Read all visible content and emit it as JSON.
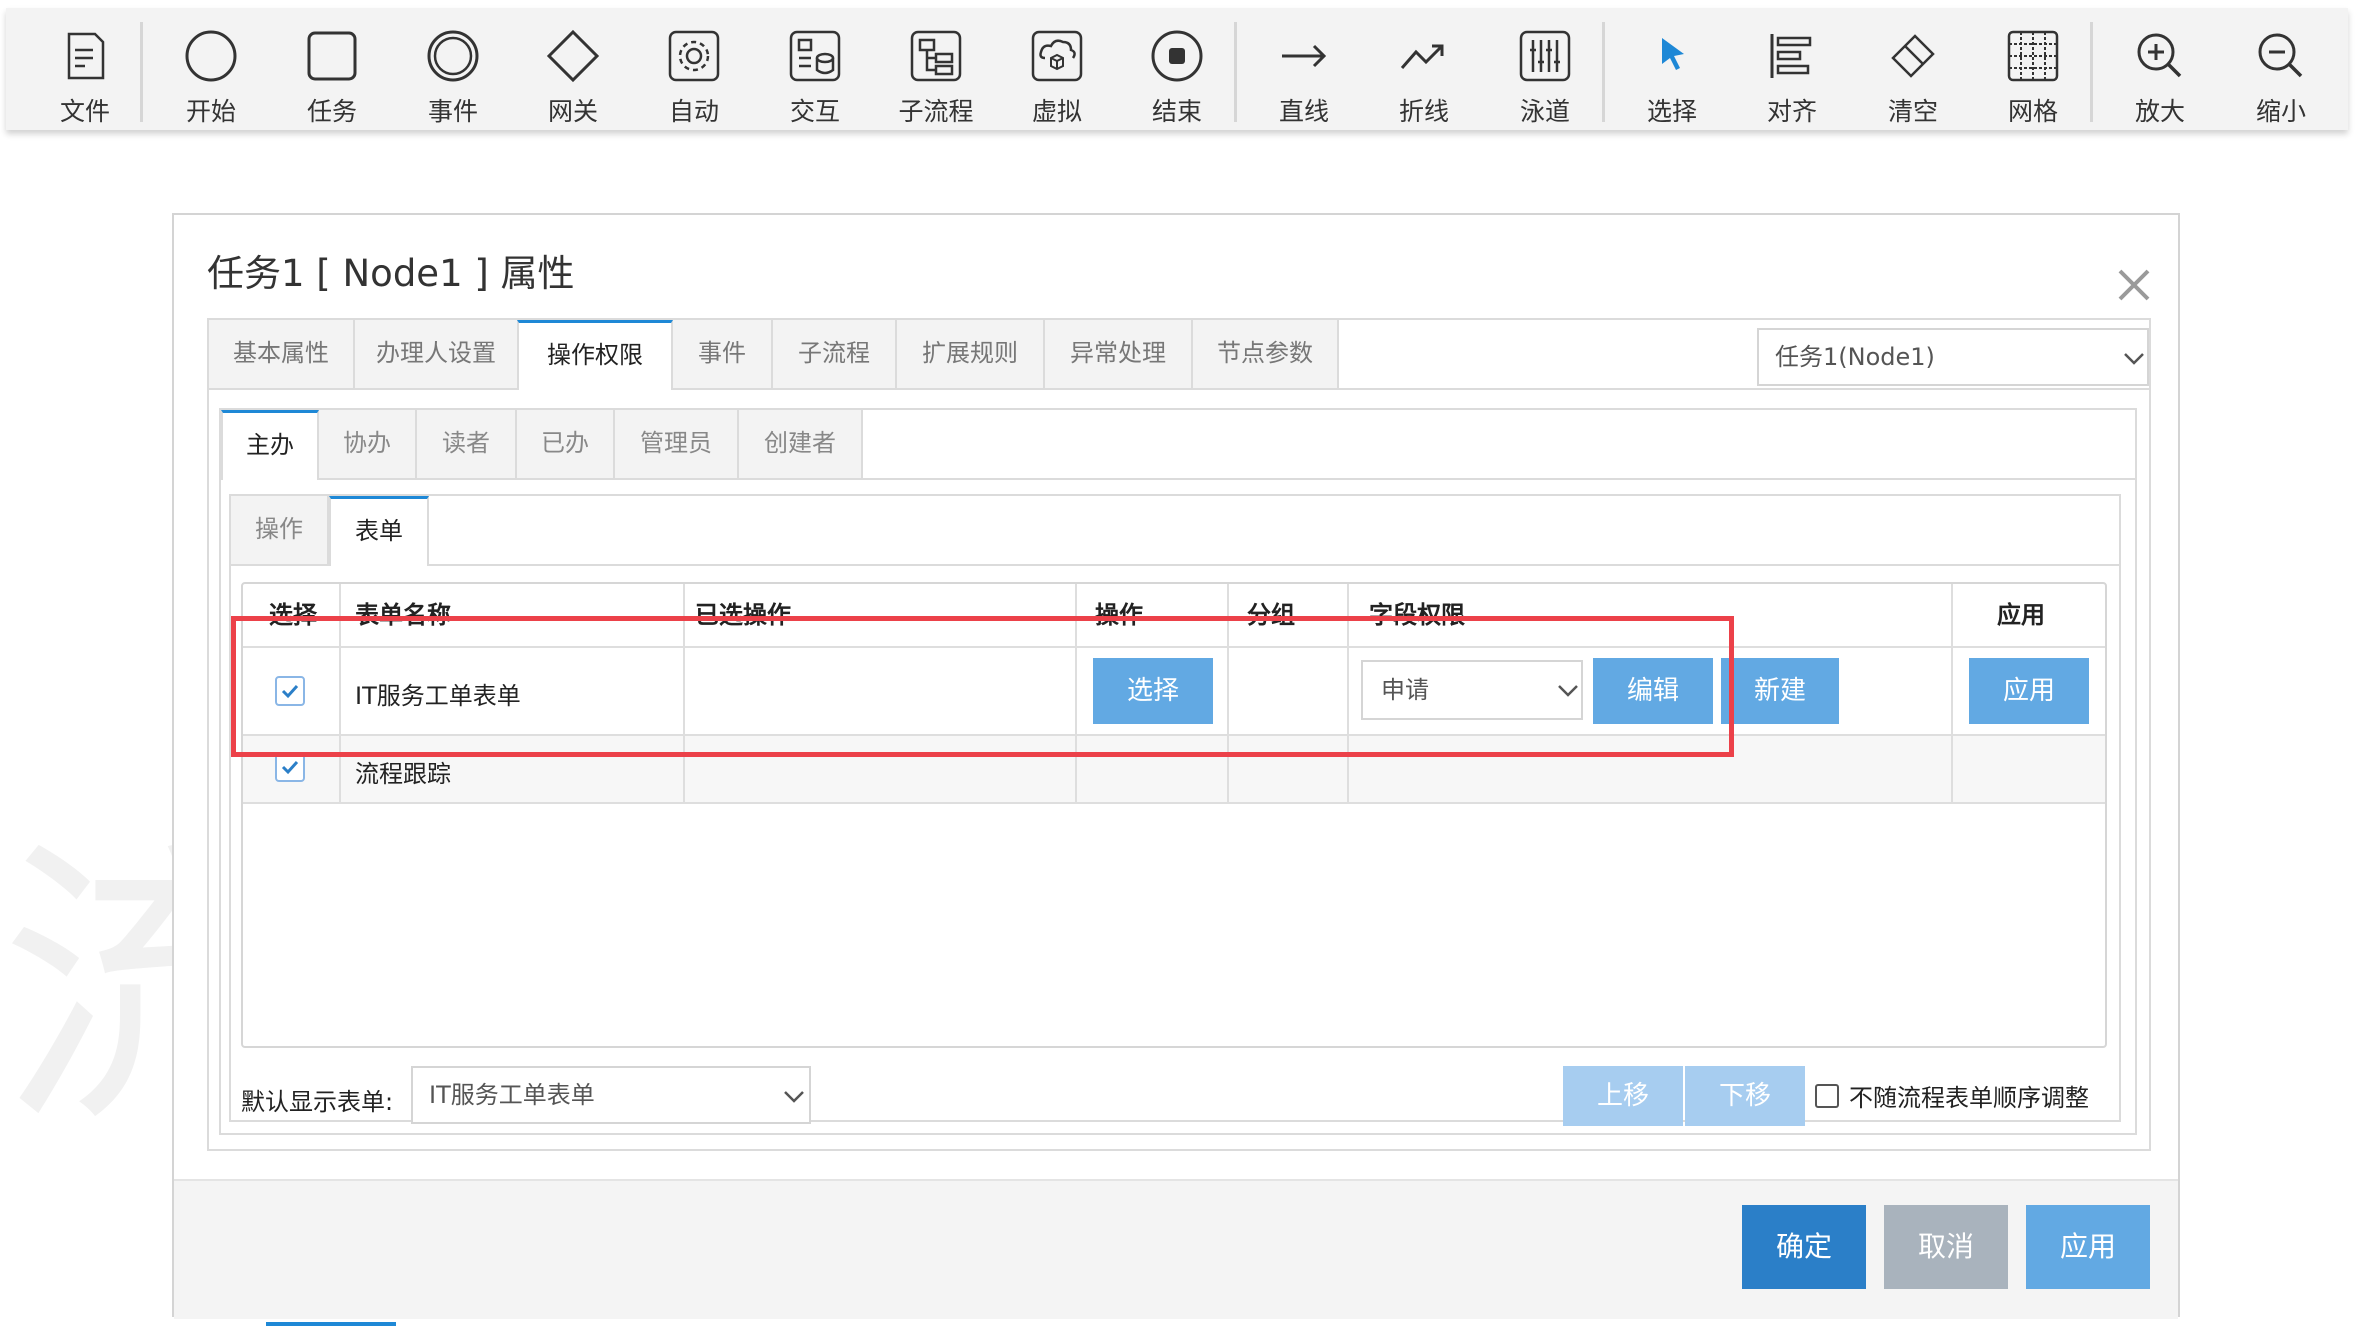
{
  "toolbar": {
    "items": [
      {
        "label": "文件",
        "icon": "file-icon"
      },
      {
        "label": "开始",
        "icon": "start-circle-icon"
      },
      {
        "label": "任务",
        "icon": "task-square-icon"
      },
      {
        "label": "事件",
        "icon": "event-double-circle-icon"
      },
      {
        "label": "网关",
        "icon": "gateway-diamond-icon"
      },
      {
        "label": "自动",
        "icon": "automatic-gear-icon"
      },
      {
        "label": "交互",
        "icon": "interaction-icon"
      },
      {
        "label": "子流程",
        "icon": "subprocess-icon"
      },
      {
        "label": "虚拟",
        "icon": "virtual-cube-icon"
      },
      {
        "label": "结束",
        "icon": "end-circle-icon"
      },
      {
        "label": "直线",
        "icon": "straight-arrow-icon"
      },
      {
        "label": "折线",
        "icon": "polyline-arrow-icon"
      },
      {
        "label": "泳道",
        "icon": "swimlane-icon"
      },
      {
        "label": "选择",
        "icon": "select-cursor-icon"
      },
      {
        "label": "对齐",
        "icon": "align-icon"
      },
      {
        "label": "清空",
        "icon": "clear-eraser-icon"
      },
      {
        "label": "网格",
        "icon": "grid-icon"
      },
      {
        "label": "放大",
        "icon": "zoom-in-icon"
      },
      {
        "label": "缩小",
        "icon": "zoom-out-icon"
      }
    ]
  },
  "watermark": "流",
  "dialog": {
    "title": "任务1 [ Node1 ] 属性",
    "tabs": [
      "基本属性",
      "办理人设置",
      "操作权限",
      "事件",
      "子流程",
      "扩展规则",
      "异常处理",
      "节点参数"
    ],
    "active_tab": "操作权限",
    "node_select": "任务1(Node1)",
    "role_tabs": [
      "主办",
      "协办",
      "读者",
      "已办",
      "管理员",
      "创建者"
    ],
    "active_role_tab": "主办",
    "inner_tabs": [
      "操作",
      "表单"
    ],
    "active_inner_tab": "表单",
    "table": {
      "headers": [
        "选择",
        "表单名称",
        "已选操作",
        "操作",
        "分组",
        "字段权限",
        "应用"
      ],
      "rows": [
        {
          "checked": true,
          "name": "IT服务工单表单",
          "selected_ops": "",
          "op_button": "选择",
          "group": "",
          "field_perm": "申请",
          "edit_button": "编辑",
          "new_button": "新建",
          "apply_button": "应用"
        },
        {
          "checked": true,
          "name": "流程跟踪",
          "selected_ops": "",
          "group": "",
          "field_perm": ""
        }
      ]
    },
    "default_form_label": "默认显示表单:",
    "default_form_value": "IT服务工单表单",
    "move_up": "上移",
    "move_down": "下移",
    "no_reorder_label": "不随流程表单顺序调整",
    "no_reorder_checked": false,
    "footer": {
      "ok": "确定",
      "cancel": "取消",
      "apply": "应用"
    }
  },
  "colors": {
    "primary": "#2b7fc8",
    "button_blue": "#62a9e3",
    "button_light": "#a7cdf0",
    "cancel_gray": "#a9b3bd",
    "highlight_red": "#ec4149",
    "tab_accent": "#1e88d6"
  }
}
